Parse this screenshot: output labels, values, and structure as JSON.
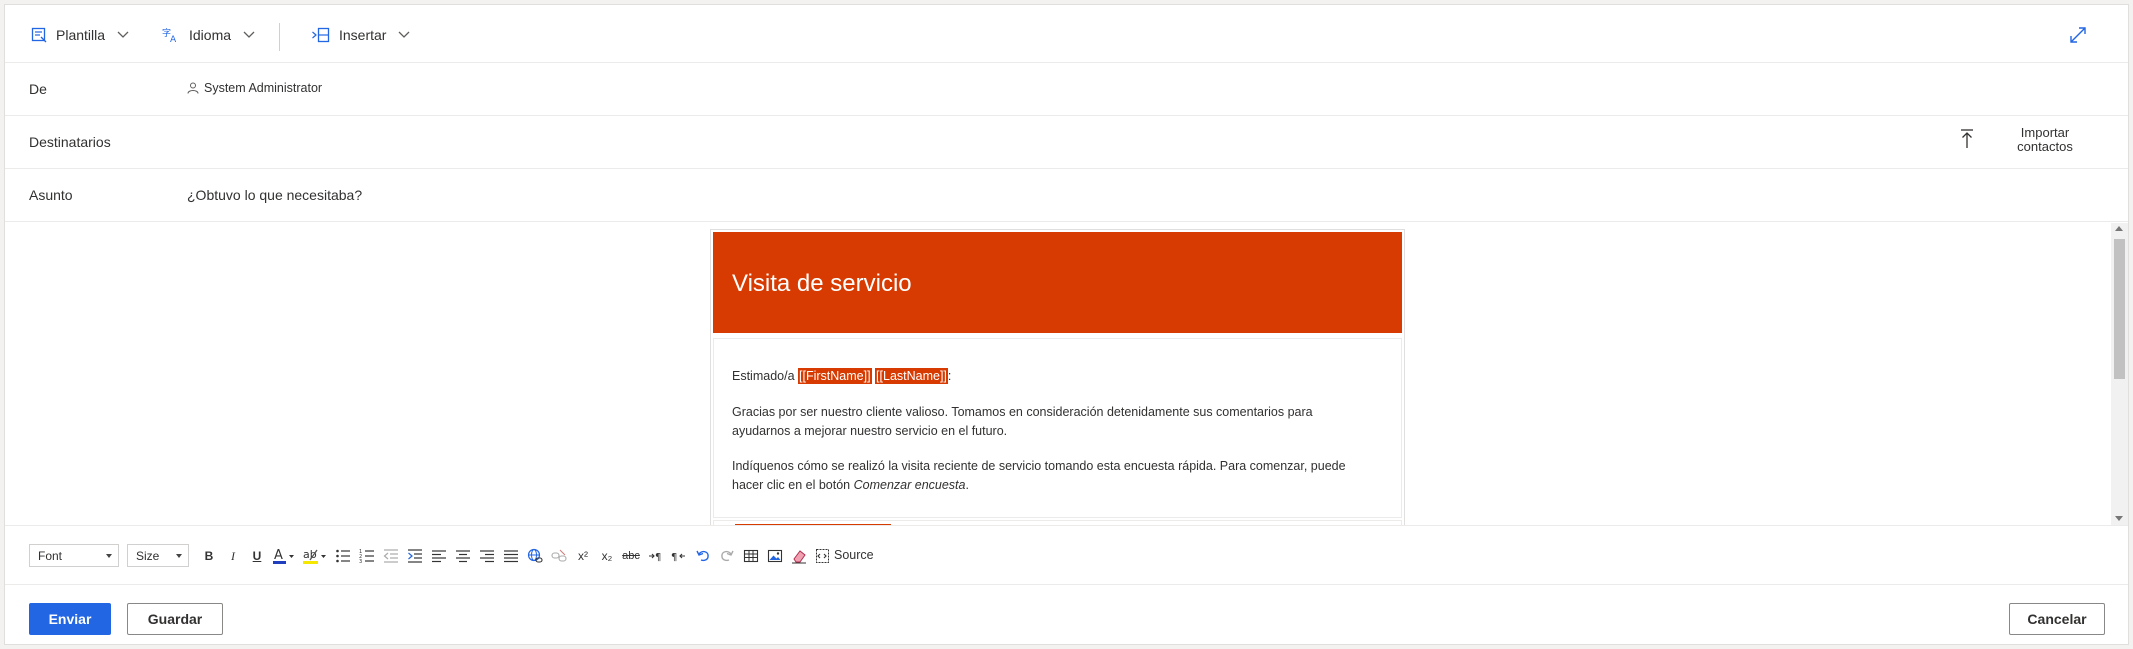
{
  "commandbar": {
    "template_label": "Plantilla",
    "language_label": "Idioma",
    "insert_label": "Insertar"
  },
  "fields": {
    "from_label": "De",
    "from_value": "System Administrator",
    "to_label": "Destinatarios",
    "import_label_1": "Importar",
    "import_label_2": "contactos",
    "subject_label": "Asunto",
    "subject_value": "¿Obtuvo lo que necesitaba?"
  },
  "email": {
    "banner_title": "Visita de servicio",
    "greeting_prefix": "Estimado/a ",
    "first_name_tag": "[[FirstName]]",
    "last_name_tag": "[[LastName]]",
    "greeting_suffix": ":",
    "paragraph_1": "Gracias por ser nuestro cliente valioso. Tomamos en consideración detenidamente sus comentarios para ayudarnos a mejorar nuestro servicio en el futuro.",
    "paragraph_2_prefix": "Indíquenos cómo se realizó la visita reciente de servicio tomando esta encuesta rápida. Para comenzar, puede hacer clic en el botón ",
    "paragraph_2_em": "Comenzar encuesta",
    "paragraph_2_suffix": "."
  },
  "toolbar": {
    "font_label": "Font",
    "size_label": "Size",
    "bold": "B",
    "italic": "I",
    "underline": "U",
    "superscript": "x²",
    "subscript": "x₂",
    "strike": "abc",
    "source_label": "Source"
  },
  "footer": {
    "send_label": "Enviar",
    "save_label": "Guardar",
    "cancel_label": "Cancelar"
  },
  "colors": {
    "accent": "#d83b01",
    "primary_button": "#2266e3",
    "icon_blue": "#2266e3"
  }
}
